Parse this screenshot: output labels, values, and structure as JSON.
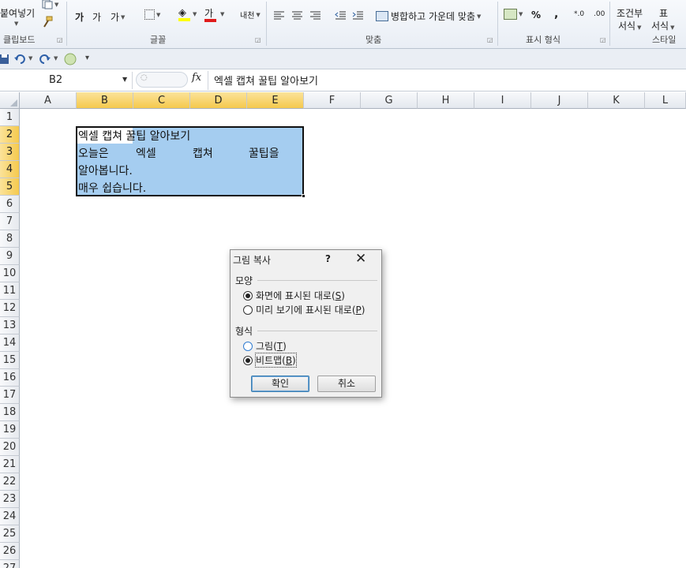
{
  "ribbon": {
    "clipboard": {
      "paste_label": "붙여넣기",
      "group_label": "클립보드"
    },
    "font": {
      "group_label": "글꼴",
      "grow_label": "가",
      "shrink_label": "가",
      "clear_label": "가",
      "font_color_label": "가",
      "phonetic_label": "내천"
    },
    "alignment": {
      "group_label": "맞춤",
      "merge_label": "병합하고 가운데 맞춤"
    },
    "number": {
      "group_label": "표시 형식",
      "percent_label": "%",
      "comma_label": ",",
      "decimal_label": "*.0"
    },
    "styles": {
      "group_label": "스타일",
      "conditional_label_1": "조건부",
      "conditional_label_2": "서식",
      "table_label_1": "표",
      "table_label_2": "서식"
    }
  },
  "formula_bar": {
    "name_box": "B2",
    "fx_label": "fx",
    "content": "엑셀 캡쳐 꿀팁 알아보기"
  },
  "grid": {
    "columns": [
      "A",
      "B",
      "C",
      "D",
      "E",
      "F",
      "G",
      "H",
      "I",
      "J",
      "K",
      "L"
    ],
    "rows": [
      "1",
      "2",
      "3",
      "4",
      "5",
      "6",
      "7",
      "8",
      "9",
      "10",
      "11",
      "12",
      "13",
      "14",
      "15",
      "16",
      "17",
      "18",
      "19",
      "20",
      "21",
      "22",
      "23",
      "24",
      "25",
      "26",
      "27"
    ],
    "cells": {
      "b2": "엑셀 캡쳐 꿀팁 알아보기",
      "b3": "오늘은",
      "c3": "엑셀",
      "d3": "캡쳐",
      "e3": "꿀팁을",
      "b4": "알아봅니다.",
      "b5": "매우 쉽습니다."
    }
  },
  "dialog": {
    "title": "그림 복사",
    "help_label": "?",
    "close_label": "✕",
    "appearance_label": "모양",
    "appearance_options": [
      {
        "text": "화면에 표시된 대로(",
        "key": "S",
        "suffix": ")",
        "checked": true
      },
      {
        "text": "미리 보기에 표시된 대로(",
        "key": "P",
        "suffix": ")",
        "checked": false
      }
    ],
    "format_label": "형식",
    "format_options": [
      {
        "text": "그림(",
        "key": "T",
        "suffix": ")",
        "checked": false
      },
      {
        "text": "비트맵(",
        "key": "B",
        "suffix": ")",
        "checked": true
      }
    ],
    "ok_label": "확인",
    "cancel_label": "취소"
  }
}
